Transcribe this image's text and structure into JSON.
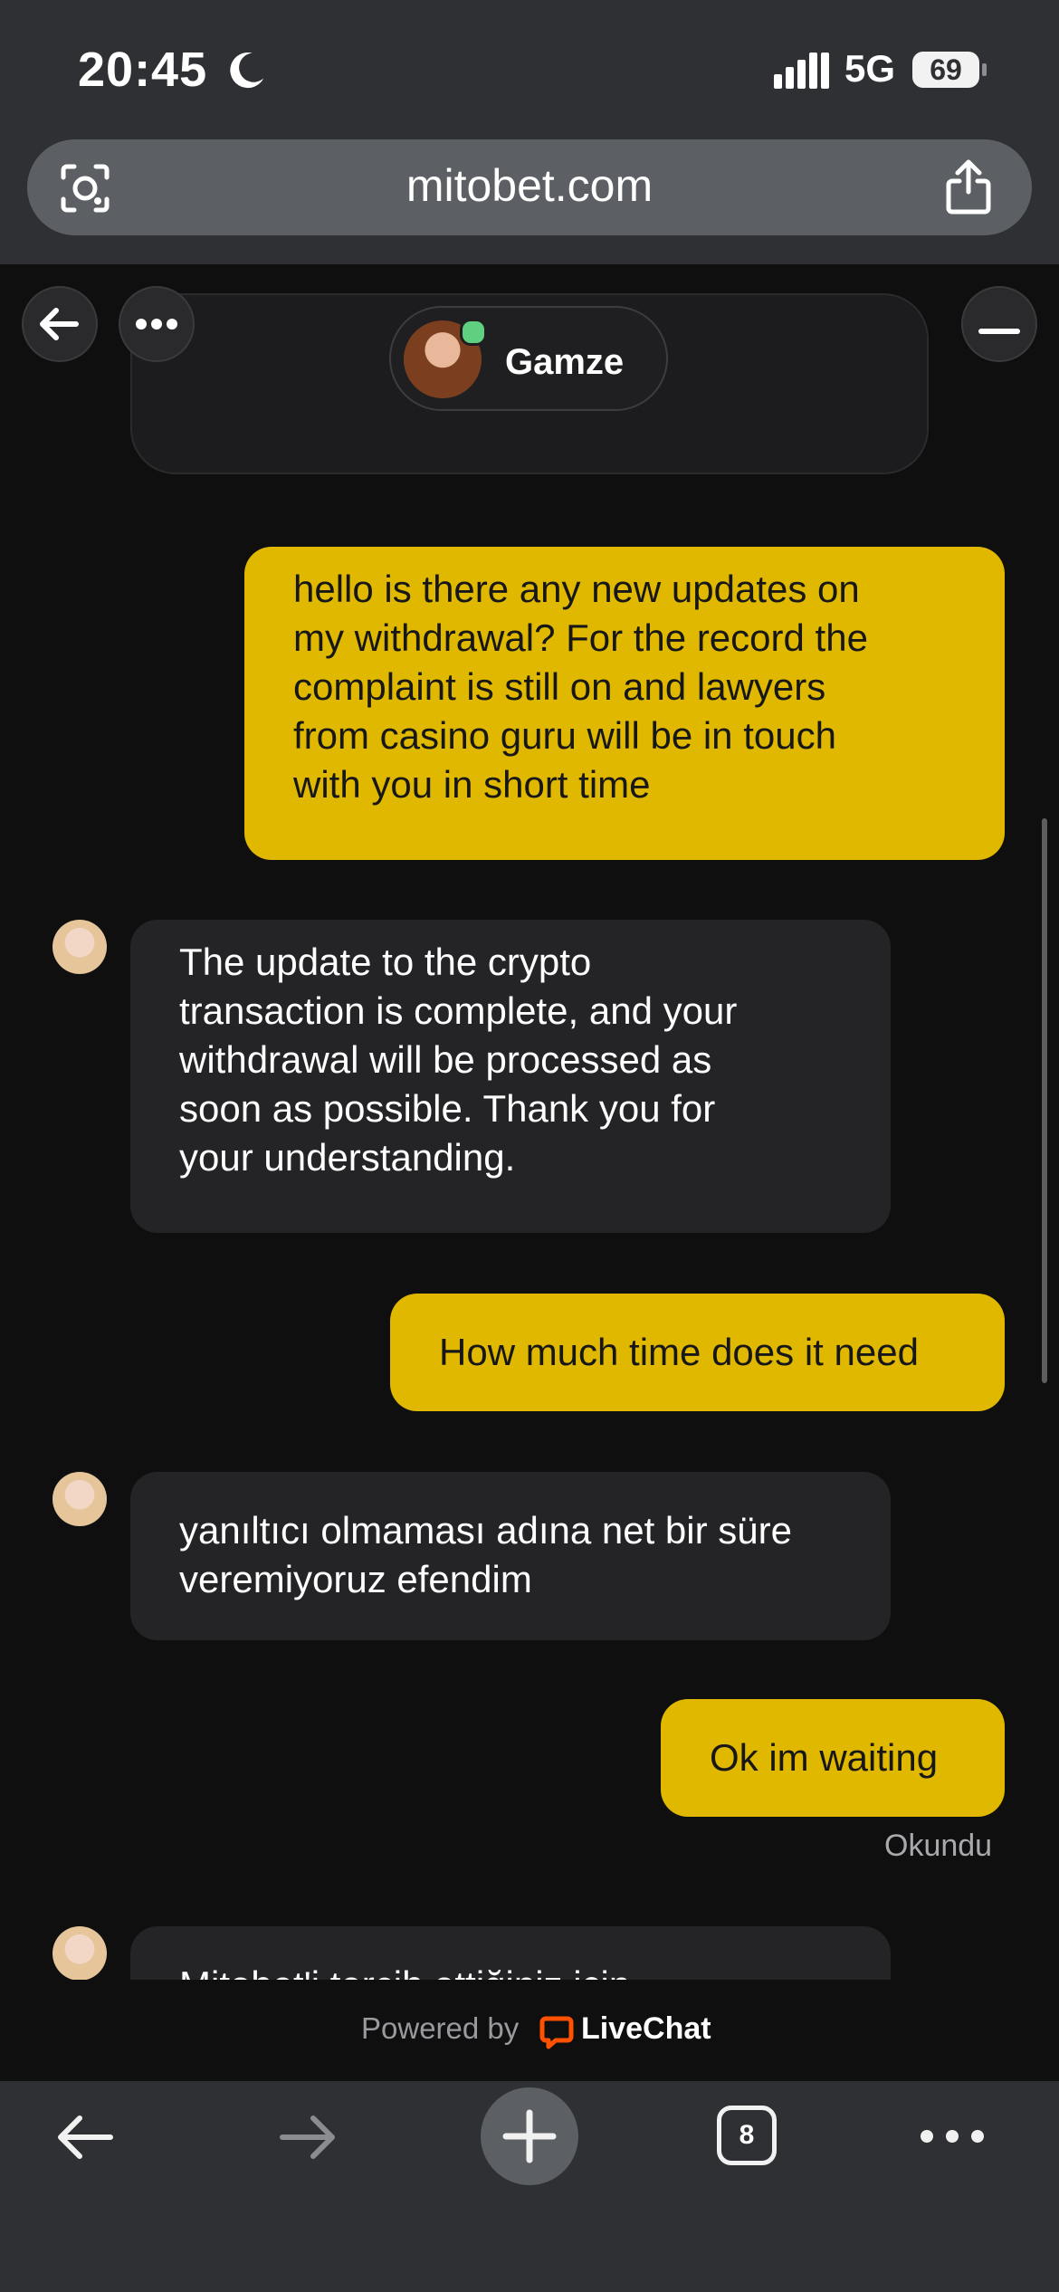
{
  "status_bar": {
    "time": "20:45",
    "network": "5G",
    "battery": "69"
  },
  "browser": {
    "url": "mitobet.com",
    "tab_count": "8"
  },
  "chat": {
    "agent_name": "Gamze",
    "messages": [
      {
        "sender": "user",
        "text": "hello is there any new updates on\nmy withdrawal? For the record the\ncomplaint is still on and lawyers\nfrom casino guru will be in touch\nwith you in short time"
      },
      {
        "sender": "agent",
        "text": "The update to the crypto\ntransaction is complete, and your\nwithdrawal will be processed as\nsoon as possible. Thank you for\nyour understanding."
      },
      {
        "sender": "user",
        "text": "How much time does it need"
      },
      {
        "sender": "agent",
        "text": "yanıltıcı olmaması adına net bir süre\nveremiyoruz efendim"
      },
      {
        "sender": "user",
        "text": "Ok im waiting"
      },
      {
        "sender": "agent",
        "text": "Mitobet'i tercih ettiğiniz için"
      }
    ],
    "read_status": "Okundu"
  },
  "footer": {
    "powered_by": "Powered by",
    "brand": "LiveChat"
  },
  "colors": {
    "accent": "#e0b800",
    "online": "#5fd07f",
    "livechat": "#ff5100"
  },
  "icons": [
    "back-arrow-icon",
    "more-icon",
    "minimize-icon",
    "lens-icon",
    "share-icon",
    "livechat-logo-icon",
    "forward-arrow-icon",
    "plus-icon",
    "tabs-icon"
  ]
}
